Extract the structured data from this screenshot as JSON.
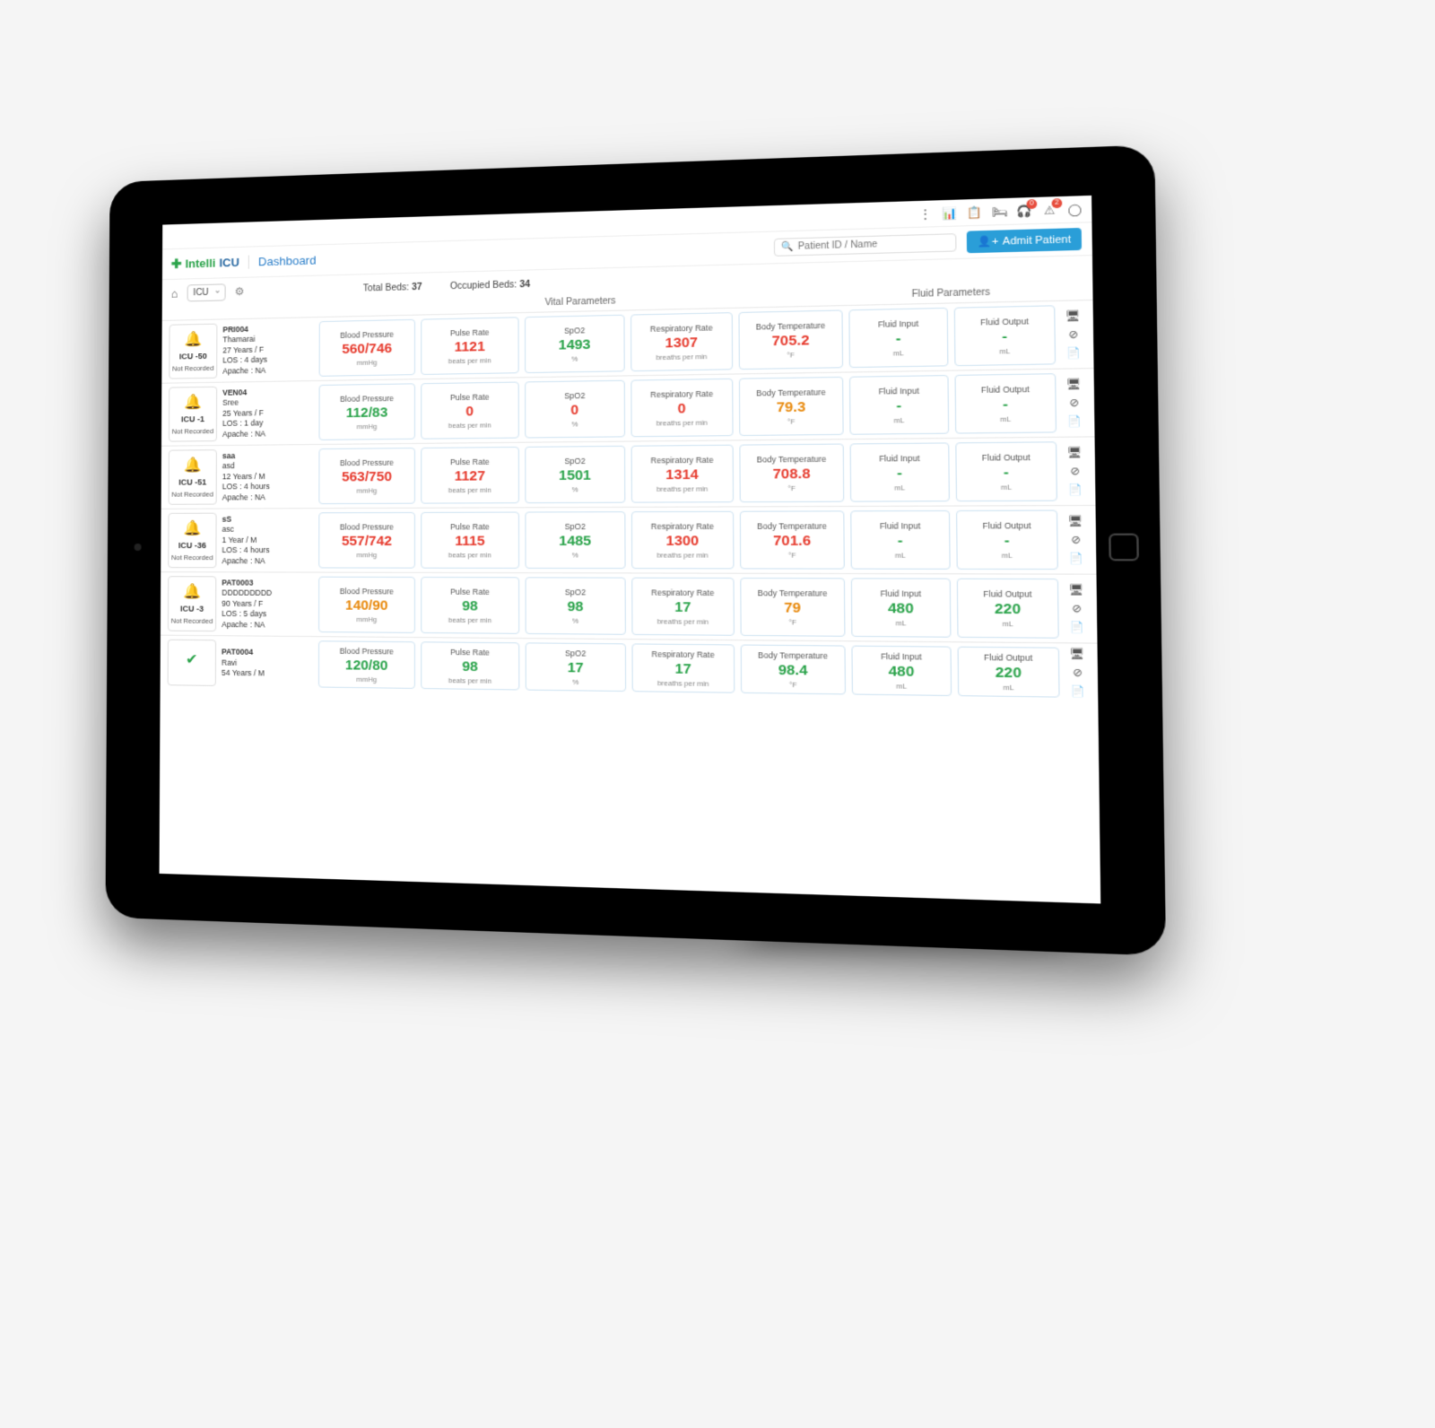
{
  "brand": {
    "part1": "Intelli",
    "part2": "ICU"
  },
  "page_title": "Dashboard",
  "search": {
    "placeholder": "Patient ID / Name"
  },
  "admit_button": "Admit Patient",
  "ward": {
    "selected": "ICU"
  },
  "beds": {
    "total_label": "Total Beds:",
    "total": "37",
    "occupied_label": "Occupied Beds:",
    "occupied": "34"
  },
  "section_headers": {
    "vital": "Vital Parameters",
    "fluid": "Fluid Parameters"
  },
  "metric_labels": {
    "bp": "Blood Pressure",
    "bp_unit": "mmHg",
    "pulse": "Pulse Rate",
    "pulse_unit": "beats per min",
    "spo2": "SpO2",
    "spo2_unit": "%",
    "resp": "Respiratory Rate",
    "resp_unit": "breaths per min",
    "temp": "Body Temperature",
    "temp_unit": "°F",
    "fin": "Fluid Input",
    "fout": "Fluid Output",
    "fluid_unit": "mL"
  },
  "patients": [
    {
      "alert": "red",
      "bed": "ICU -50",
      "status": "Not Recorded",
      "pid": "PRI004",
      "name": "Thamarai",
      "agegender": "27 Years / F",
      "los": "LOS : 4 days",
      "apache": "Apache : NA",
      "bp": {
        "v": "560/746",
        "c": "red"
      },
      "pulse": {
        "v": "1121",
        "c": "red"
      },
      "spo2": {
        "v": "1493",
        "c": "green"
      },
      "resp": {
        "v": "1307",
        "c": "red"
      },
      "temp": {
        "v": "705.2",
        "c": "red"
      },
      "fin": {
        "v": "-",
        "c": "green"
      },
      "fout": {
        "v": "-",
        "c": "green"
      }
    },
    {
      "alert": "red",
      "bed": "ICU -1",
      "status": "Not Recorded",
      "pid": "VEN04",
      "name": "Sree",
      "agegender": "25 Years / F",
      "los": "LOS : 1 day",
      "apache": "Apache : NA",
      "bp": {
        "v": "112/83",
        "c": "green"
      },
      "pulse": {
        "v": "0",
        "c": "red"
      },
      "spo2": {
        "v": "0",
        "c": "red"
      },
      "resp": {
        "v": "0",
        "c": "red"
      },
      "temp": {
        "v": "79.3",
        "c": "orange"
      },
      "fin": {
        "v": "-",
        "c": "green"
      },
      "fout": {
        "v": "-",
        "c": "green"
      }
    },
    {
      "alert": "red",
      "bed": "ICU -51",
      "status": "Not Recorded",
      "pid": "saa",
      "name": "asd",
      "agegender": "12 Years / M",
      "los": "LOS : 4 hours",
      "apache": "Apache : NA",
      "bp": {
        "v": "563/750",
        "c": "red"
      },
      "pulse": {
        "v": "1127",
        "c": "red"
      },
      "spo2": {
        "v": "1501",
        "c": "green"
      },
      "resp": {
        "v": "1314",
        "c": "red"
      },
      "temp": {
        "v": "708.8",
        "c": "red"
      },
      "fin": {
        "v": "-",
        "c": "green"
      },
      "fout": {
        "v": "-",
        "c": "green"
      }
    },
    {
      "alert": "red",
      "bed": "ICU -36",
      "status": "Not Recorded",
      "pid": "sS",
      "name": "asc",
      "agegender": "1 Year / M",
      "los": "LOS : 4 hours",
      "apache": "Apache : NA",
      "bp": {
        "v": "557/742",
        "c": "red"
      },
      "pulse": {
        "v": "1115",
        "c": "red"
      },
      "spo2": {
        "v": "1485",
        "c": "green"
      },
      "resp": {
        "v": "1300",
        "c": "red"
      },
      "temp": {
        "v": "701.6",
        "c": "red"
      },
      "fin": {
        "v": "-",
        "c": "green"
      },
      "fout": {
        "v": "-",
        "c": "green"
      }
    },
    {
      "alert": "red",
      "bed": "ICU -3",
      "status": "Not Recorded",
      "pid": "PAT0003",
      "name": "DDDDDDDDD",
      "agegender": "90 Years / F",
      "los": "LOS : 5 days",
      "apache": "Apache : NA",
      "bp": {
        "v": "140/90",
        "c": "orange"
      },
      "pulse": {
        "v": "98",
        "c": "green"
      },
      "spo2": {
        "v": "98",
        "c": "green"
      },
      "resp": {
        "v": "17",
        "c": "green"
      },
      "temp": {
        "v": "79",
        "c": "orange"
      },
      "fin": {
        "v": "480",
        "c": "green"
      },
      "fout": {
        "v": "220",
        "c": "green"
      }
    },
    {
      "alert": "green",
      "bed": "",
      "status": "",
      "pid": "PAT0004",
      "name": "Ravi",
      "agegender": "54 Years / M",
      "los": "",
      "apache": "",
      "bp": {
        "v": "120/80",
        "c": "green"
      },
      "pulse": {
        "v": "98",
        "c": "green"
      },
      "spo2": {
        "v": "17",
        "c": "green"
      },
      "resp": {
        "v": "17",
        "c": "green"
      },
      "temp": {
        "v": "98.4",
        "c": "green"
      },
      "fin": {
        "v": "480",
        "c": "green"
      },
      "fout": {
        "v": "220",
        "c": "green"
      }
    }
  ]
}
